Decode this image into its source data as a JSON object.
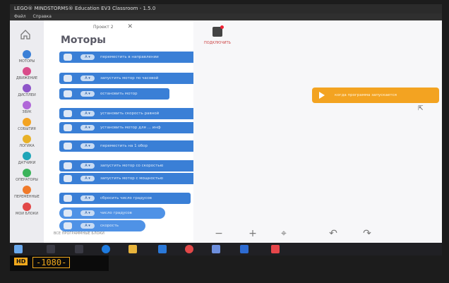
{
  "window": {
    "title": "LEGO® MINDSTORMS® Education EV3 Classroom - 1.5.0",
    "menu": [
      "Файл",
      "Справка"
    ]
  },
  "project_tab": {
    "label": "Проект 2",
    "close": "✕"
  },
  "palette": {
    "title": "Моторы",
    "blocks": [
      {
        "port": "A ▾",
        "text": "переместить в направлении"
      },
      {
        "port": "A ▾",
        "text": "запустить мотор по часовой"
      },
      {
        "port": "A ▾",
        "text": "остановить мотор"
      },
      {
        "port": "A ▾",
        "text": "установить скорость равной"
      },
      {
        "port": "A ▾",
        "text": "установить мотор для … инф"
      },
      {
        "port": "A ▾",
        "text": "переместить на 1 обор"
      },
      {
        "port": "A ▾",
        "text": "запустить мотор со скоростью"
      },
      {
        "port": "A ▾",
        "text": "запустить мотор с мощностью"
      },
      {
        "port": "A ▾",
        "text": "сбросить число градусов"
      },
      {
        "port": "A ▾",
        "text": "число градусов"
      },
      {
        "port": "A ▾",
        "text": "скорость"
      }
    ],
    "footer": "ВСЕ ПРОГРАММНЫЕ БЛОКИ"
  },
  "categories": [
    {
      "label": "МОТОРЫ",
      "color": "#3a7fd6"
    },
    {
      "label": "ДВИЖЕНИЕ",
      "color": "#d94c8a"
    },
    {
      "label": "ДИСПЛЕИ",
      "color": "#8e55c9"
    },
    {
      "label": "ЗВУК",
      "color": "#b067d8"
    },
    {
      "label": "СОБЫТИЯ",
      "color": "#f3a321"
    },
    {
      "label": "ЛОГИКА",
      "color": "#e8b128"
    },
    {
      "label": "ДАТЧИКИ",
      "color": "#1fa5b8"
    },
    {
      "label": "ОПЕРАТОРЫ",
      "color": "#3bb35a"
    },
    {
      "label": "ПЕРЕМЕННЫЕ",
      "color": "#f07a2a"
    },
    {
      "label": "МОИ БЛОКИ",
      "color": "#e24848"
    }
  ],
  "workspace": {
    "connect_label": "ПОДКЛЮЧИТЬ",
    "start_block": "когда программа запускается",
    "zoom_out": "−",
    "zoom_in": "+",
    "center": "⌖",
    "undo": "↶",
    "redo": "↷"
  },
  "taskbar": {
    "icons": [
      "windows-icon",
      "search-icon",
      "taskview-icon",
      "edge-icon",
      "explorer-icon",
      "mail-icon",
      "yandex-icon",
      "downloads-icon",
      "store-icon",
      "ev3-icon"
    ]
  },
  "lcd": {
    "tag": "НD",
    "value": "-1080-"
  },
  "colors": {
    "motor_blue": "#3a7fd6",
    "event_orange": "#f3a321"
  }
}
